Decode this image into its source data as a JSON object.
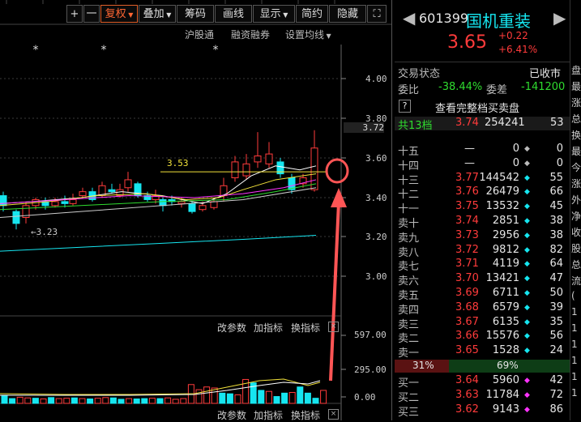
{
  "toolbar": {
    "plus": "+",
    "minus": "一",
    "fuquan": "复权",
    "diejia": "叠加",
    "chouma": "筹码",
    "huaxian": "画线",
    "xianshi": "显示",
    "jianyue": "简约",
    "yincang": "隐藏",
    "expand": "⛶"
  },
  "chart_links": {
    "hugutong": "沪股通",
    "rongzi": "融资融券",
    "junxian": "设置均线"
  },
  "price_axis": {
    "labels": [
      "4.00",
      "3.80",
      "3.72",
      "3.60",
      "3.40",
      "3.20",
      "3.00"
    ]
  },
  "annotations": {
    "level_label": "3.53",
    "low_label": "3.23"
  },
  "indicator_bar": {
    "gaicanshu": "改参数",
    "jiazhibiao": "加指标",
    "huanzhibiao": "换指标",
    "close": "×"
  },
  "volume_axis": {
    "labels": [
      "597.00",
      "295.00",
      "0.00"
    ]
  },
  "stock": {
    "code": "601399",
    "name": "国机重装",
    "price": "3.65",
    "change": "+0.22",
    "pct": "+6.41%",
    "status_label": "交易状态",
    "status_value": "已收市",
    "weibi_label": "委比",
    "weibi_value": "-38.44%",
    "weicha_label": "委差",
    "weicha_value": "-141200",
    "help": "?",
    "full_book": "查看完整档买卖盘",
    "total_label": "共13档",
    "total_price": "3.74",
    "total_vol": "254241",
    "total_count": "53"
  },
  "asks": [
    {
      "label": "十五",
      "price": "—",
      "vol": "0",
      "cnt": "0"
    },
    {
      "label": "十四",
      "price": "—",
      "vol": "0",
      "cnt": "0"
    },
    {
      "label": "十三",
      "price": "3.77",
      "vol": "144542",
      "cnt": "55"
    },
    {
      "label": "十二",
      "price": "3.76",
      "vol": "26479",
      "cnt": "66"
    },
    {
      "label": "十一",
      "price": "3.75",
      "vol": "13532",
      "cnt": "45"
    },
    {
      "label": "卖十",
      "price": "3.74",
      "vol": "2851",
      "cnt": "38"
    },
    {
      "label": "卖九",
      "price": "3.73",
      "vol": "2956",
      "cnt": "38"
    },
    {
      "label": "卖八",
      "price": "3.72",
      "vol": "9812",
      "cnt": "82"
    },
    {
      "label": "卖七",
      "price": "3.71",
      "vol": "4119",
      "cnt": "64"
    },
    {
      "label": "卖六",
      "price": "3.70",
      "vol": "13421",
      "cnt": "47"
    },
    {
      "label": "卖五",
      "price": "3.69",
      "vol": "6711",
      "cnt": "50"
    },
    {
      "label": "卖四",
      "price": "3.68",
      "vol": "6579",
      "cnt": "39"
    },
    {
      "label": "卖三",
      "price": "3.67",
      "vol": "6135",
      "cnt": "35"
    },
    {
      "label": "卖二",
      "price": "3.66",
      "vol": "15576",
      "cnt": "56"
    },
    {
      "label": "卖一",
      "price": "3.65",
      "vol": "1528",
      "cnt": "24"
    }
  ],
  "ratio": {
    "sell": "31%",
    "buy": "69%",
    "sell_fraction": 0.31
  },
  "bids": [
    {
      "label": "买一",
      "price": "3.64",
      "vol": "5960",
      "cnt": "42"
    },
    {
      "label": "买二",
      "price": "3.63",
      "vol": "11784",
      "cnt": "72"
    },
    {
      "label": "买三",
      "price": "3.62",
      "vol": "9143",
      "cnt": "86"
    }
  ],
  "side_strip": [
    "盘",
    "最",
    "涨",
    "总",
    "换",
    "最",
    "今",
    "涨",
    "外",
    "净",
    "收",
    "股",
    "总",
    "流",
    "(",
    "1",
    "1",
    "1",
    "1",
    "1",
    "1"
  ],
  "colors": {
    "up": "#ff3b3b",
    "down": "#16e6f0",
    "accent": "#e0602a"
  }
}
